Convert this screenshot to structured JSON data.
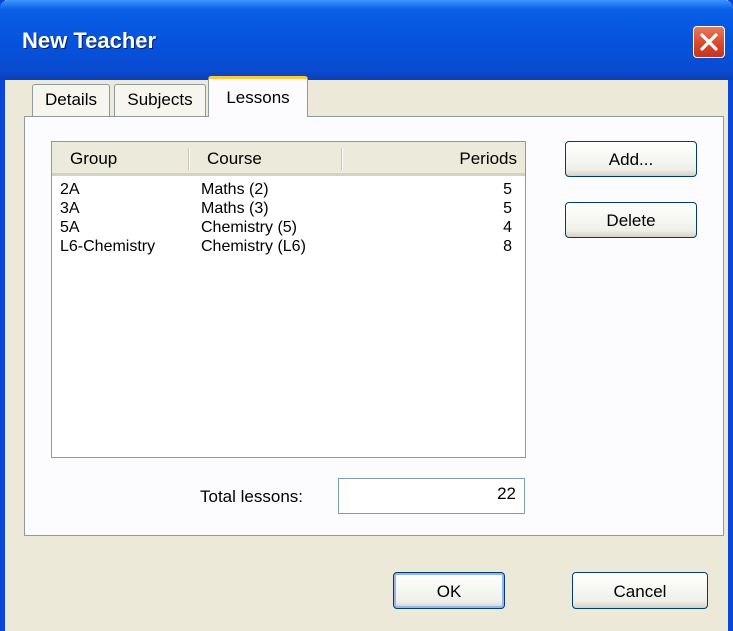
{
  "window": {
    "title": "New Teacher"
  },
  "tabs": [
    {
      "label": "Details"
    },
    {
      "label": "Subjects"
    },
    {
      "label": "Lessons"
    }
  ],
  "lessons": {
    "columns": {
      "group": "Group",
      "course": "Course",
      "periods": "Periods"
    },
    "rows": [
      {
        "group": "2A",
        "course": "Maths (2)",
        "periods": "5"
      },
      {
        "group": "3A",
        "course": "Maths (3)",
        "periods": "5"
      },
      {
        "group": "5A",
        "course": "Chemistry (5)",
        "periods": "4"
      },
      {
        "group": "L6-Chemistry",
        "course": "Chemistry (L6)",
        "periods": "8"
      }
    ],
    "add_label": "Add...",
    "delete_label": "Delete",
    "total_label": "Total lessons:",
    "total_value": "22"
  },
  "footer": {
    "ok_label": "OK",
    "cancel_label": "Cancel"
  },
  "icons": {
    "close": "close-icon"
  },
  "colors": {
    "titlebar": "#0553de",
    "close_button": "#d5462a",
    "active_tab_accent": "#ffc83c",
    "dialog_background": "#ece9d8"
  }
}
